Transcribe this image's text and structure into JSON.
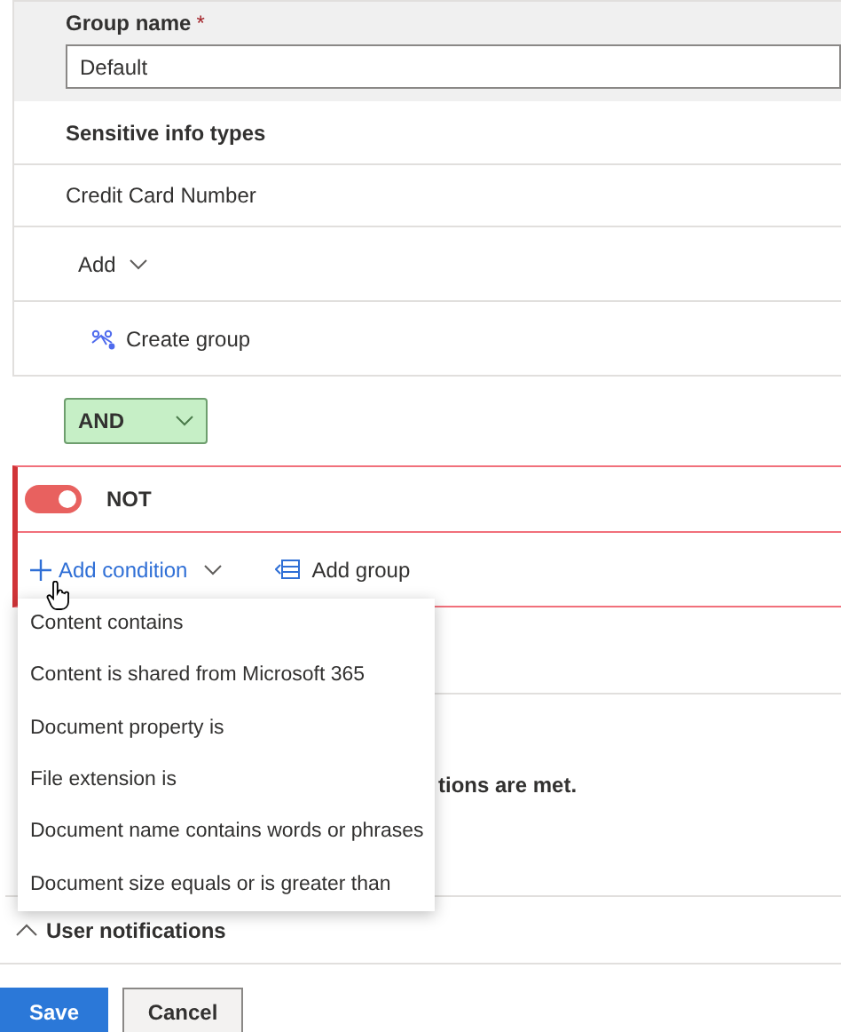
{
  "group_name": {
    "label": "Group name",
    "required_mark": "*",
    "value": "Default"
  },
  "section_title": "Sensitive info types",
  "info_types": [
    "Credit Card Number"
  ],
  "add_button": "Add",
  "create_group_button": "Create group",
  "operator": {
    "value": "AND"
  },
  "not_group": {
    "on": true,
    "label": "NOT"
  },
  "add_condition_button": "Add condition",
  "add_group_button": "Add group",
  "condition_menu": [
    {
      "label": "Content contains"
    },
    {
      "label": "Content is shared from Microsoft 365"
    },
    {
      "label": "Document property is"
    },
    {
      "label": "File extension is"
    },
    {
      "label": "Document name contains words or phrases"
    },
    {
      "label": "Document size equals or is greater than"
    }
  ],
  "hidden_text_fragments": [
    "tions are met."
  ],
  "user_notifications": {
    "label": "User notifications",
    "expanded": true
  },
  "buttons": [
    {
      "label": "Save",
      "kind": "primary"
    },
    {
      "label": "Cancel",
      "kind": "secondary"
    }
  ]
}
